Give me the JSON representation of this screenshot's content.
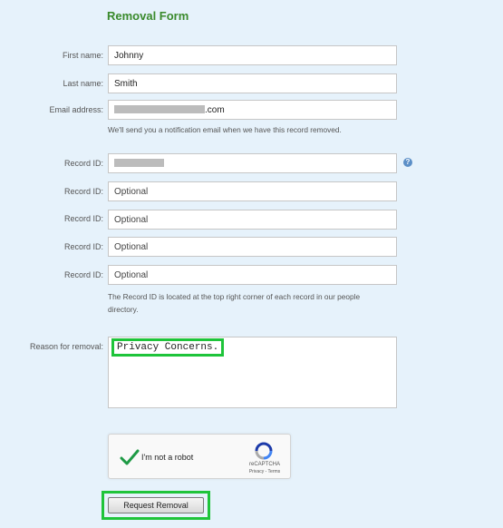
{
  "form": {
    "title": "Removal Form",
    "first_name": {
      "label": "First name:",
      "value": "Johnny"
    },
    "last_name": {
      "label": "Last name:",
      "value": "Smith"
    },
    "email": {
      "label": "Email address:",
      "value_suffix": ".com",
      "help": "We'll send you a notification email when we have this record removed."
    },
    "record_ids": [
      {
        "label": "Record ID:",
        "value": ""
      },
      {
        "label": "Record ID:",
        "placeholder": "Optional"
      },
      {
        "label": "Record ID:",
        "placeholder": "Optional"
      },
      {
        "label": "Record ID:",
        "placeholder": "Optional"
      },
      {
        "label": "Record ID:",
        "placeholder": "Optional"
      }
    ],
    "record_help_line1": "The Record ID is located at the top right corner of each record in our people",
    "record_help_line2": "directory.",
    "help_icon": "?",
    "reason": {
      "label": "Reason for removal:",
      "value": "Privacy Concerns."
    },
    "captcha": {
      "label": "I'm not a robot",
      "brand": "reCAPTCHA",
      "links": "Privacy - Terms"
    },
    "submit_label": "Request Removal"
  },
  "colors": {
    "background": "#e6f2fb",
    "title": "#3a8a2c",
    "highlight": "#1ec43a"
  }
}
